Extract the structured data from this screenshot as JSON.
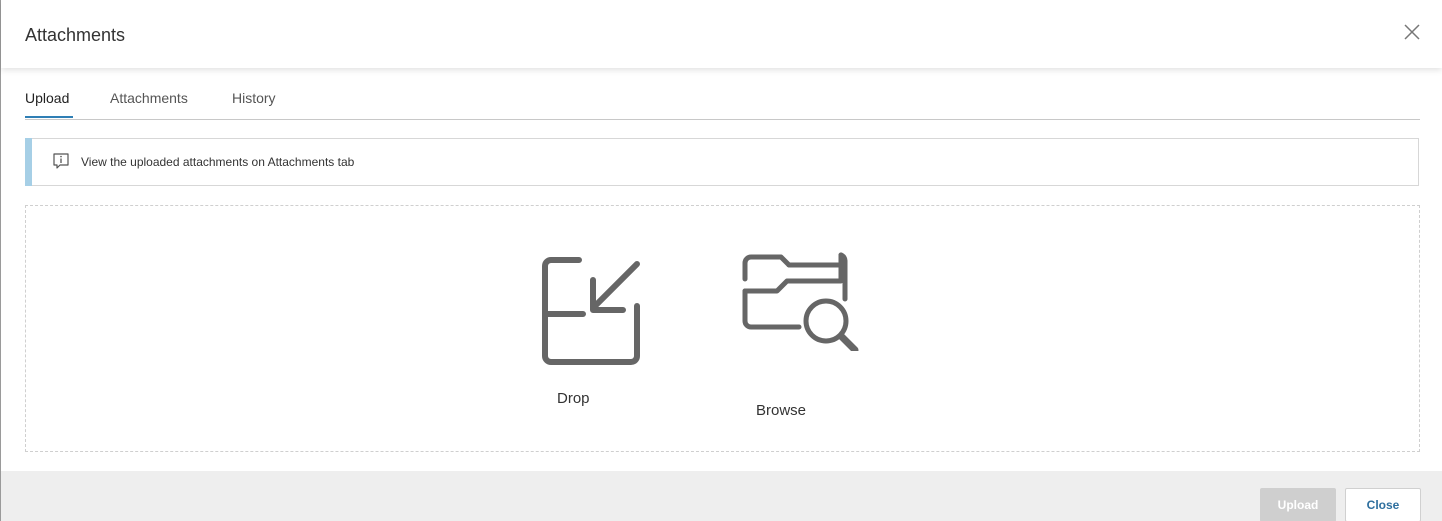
{
  "dialog": {
    "title": "Attachments"
  },
  "tabs": [
    {
      "label": "Upload",
      "active": true
    },
    {
      "label": "Attachments",
      "active": false
    },
    {
      "label": "History",
      "active": false
    }
  ],
  "info": {
    "message": "View the uploaded attachments on Attachments tab",
    "icon": "info-icon"
  },
  "dropzone": {
    "drop_label": "Drop",
    "drop_icon": "drop-arrow-icon",
    "browse_label": "Browse",
    "browse_icon": "folder-search-icon"
  },
  "footer": {
    "upload_label": "Upload",
    "upload_enabled": false,
    "close_label": "Close"
  },
  "colors": {
    "accent": "#2f7fb5",
    "info_accent": "#a6cfe6",
    "icon_gray": "#666666",
    "footer_bg": "#eeeeee",
    "disabled_button": "#cfcfcf"
  }
}
